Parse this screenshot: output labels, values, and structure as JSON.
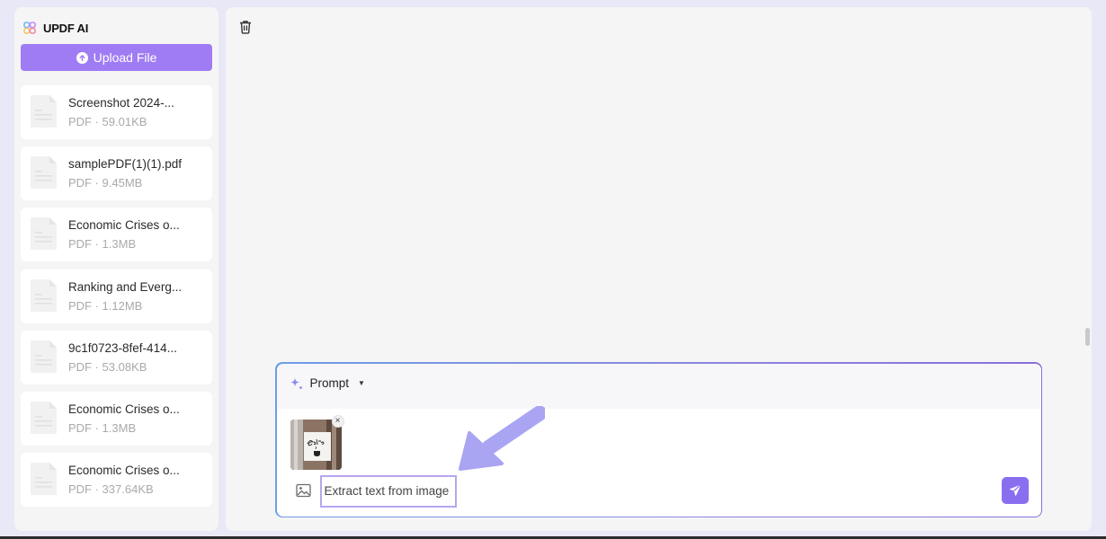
{
  "app": {
    "title": "UPDF AI",
    "brand_colors": {
      "accent": "#a07cf4",
      "send": "#8a6ef0"
    }
  },
  "sidebar": {
    "upload_button_label": "Upload File",
    "files": [
      {
        "name": "Screenshot 2024-...",
        "meta": "PDF · 59.01KB"
      },
      {
        "name": "samplePDF(1)(1).pdf",
        "meta": "PDF · 9.45MB"
      },
      {
        "name": "Economic Crises o...",
        "meta": "PDF · 1.3MB"
      },
      {
        "name": "Ranking and Everg...",
        "meta": "PDF · 1.12MB"
      },
      {
        "name": "9c1f0723-8fef-414...",
        "meta": "PDF · 53.08KB"
      },
      {
        "name": "Economic Crises o...",
        "meta": "PDF · 1.3MB"
      },
      {
        "name": "Economic Crises o...",
        "meta": "PDF · 337.64KB"
      }
    ]
  },
  "main": {
    "toolbar": {
      "delete_icon": "trash-icon"
    },
    "composer": {
      "prompt_label": "Prompt",
      "attachment": {
        "thumbnail_text": "Coffee",
        "remove_label": "×"
      },
      "input_value": "Extract text from image",
      "image_icon": "image-icon",
      "send_icon": "send-icon"
    }
  },
  "annotation": {
    "type": "arrow",
    "color": "#a9a5f2",
    "points_to": "prompt-input"
  }
}
